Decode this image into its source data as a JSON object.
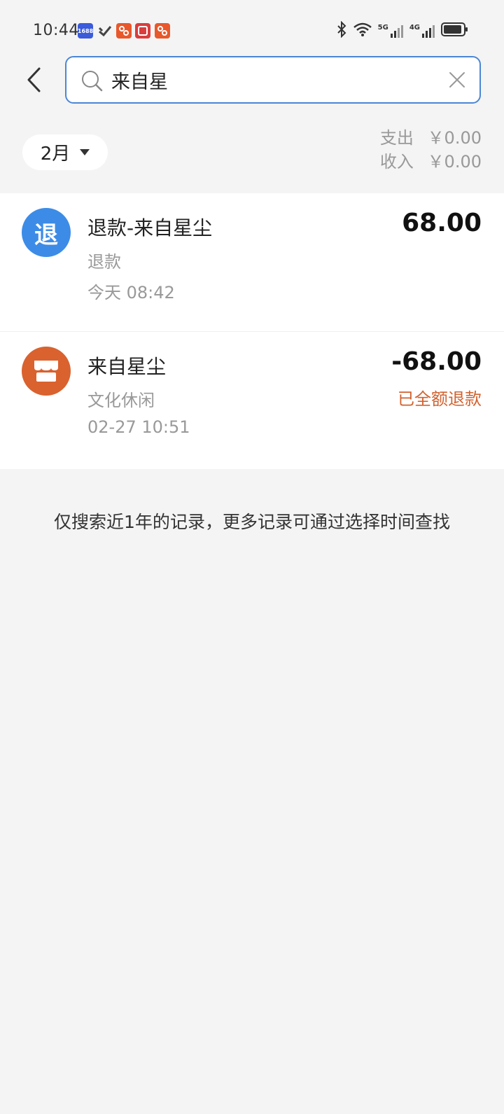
{
  "status_bar": {
    "time": "10:44",
    "apps": [
      {
        "icon": "app-1688-icon",
        "text": "1688",
        "color": "#3b5bdb"
      },
      {
        "icon": "app-check-icon",
        "text": "✓",
        "color": "#555555"
      },
      {
        "icon": "app-shop-icon",
        "text": "",
        "color": "#e8582b"
      },
      {
        "icon": "app-game-icon",
        "text": "",
        "color": "#d93d3d"
      },
      {
        "icon": "app-shop2-icon",
        "text": "",
        "color": "#e8582b"
      }
    ],
    "network1": "5G",
    "network2": "4G"
  },
  "search": {
    "value": "来自星",
    "placeholder": ""
  },
  "filter": {
    "month": "2月",
    "expense_label": "支出",
    "expense_value": "￥0.00",
    "income_label": "收入",
    "income_value": "￥0.00"
  },
  "transactions": [
    {
      "icon": "refund-icon",
      "icon_char": "退",
      "icon_color": "#3c8ce7",
      "title": "退款-来自星尘",
      "category": "退款",
      "time": "今天 08:42",
      "amount": "68.00",
      "status": ""
    },
    {
      "icon": "store-icon",
      "icon_char": "",
      "icon_color": "#d9622f",
      "title": "来自星尘",
      "category": "文化休闲",
      "time": "02-27 10:51",
      "amount": "-68.00",
      "status": "已全额退款"
    }
  ],
  "footer_note": "仅搜索近1年的记录，更多记录可通过选择时间查找",
  "colors": {
    "accent": "#4b86d6",
    "refund_status": "#d2622f",
    "background": "#f4f4f4"
  }
}
